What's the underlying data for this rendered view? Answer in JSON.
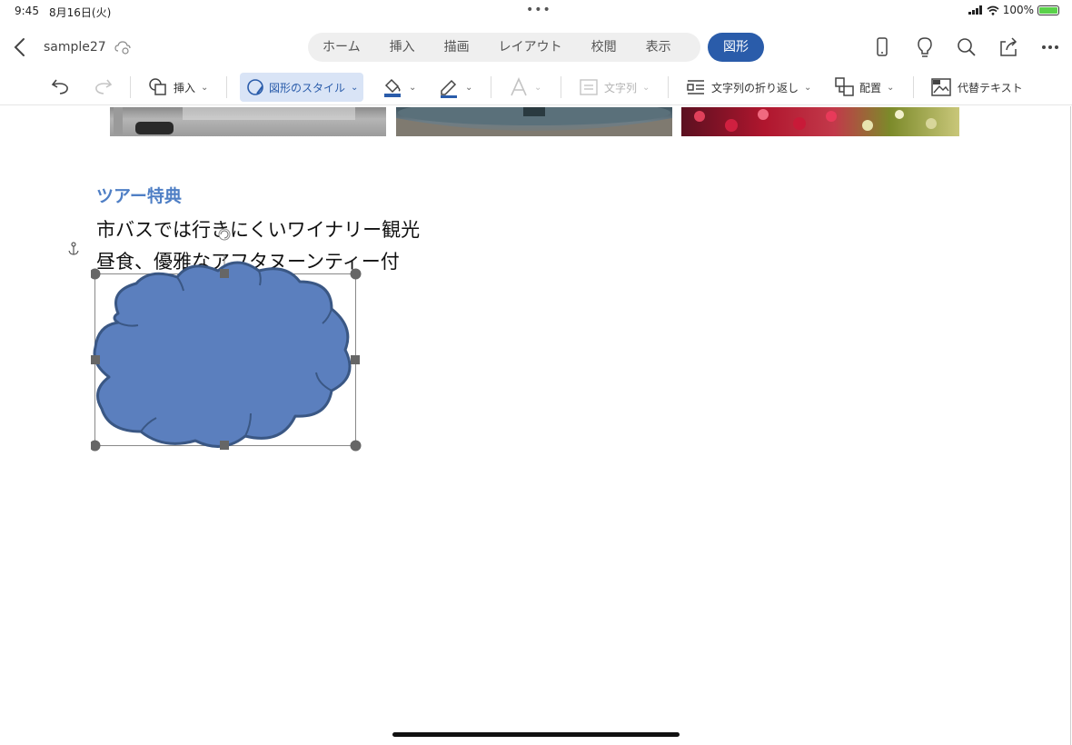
{
  "status": {
    "time": "9:45",
    "date": "8月16日(火)",
    "battery": "100%"
  },
  "header": {
    "doc_name": "sample27",
    "tabs": [
      "ホーム",
      "挿入",
      "描画",
      "レイアウト",
      "校閲",
      "表示"
    ],
    "active_tab": "図形"
  },
  "ribbon": {
    "insert": "挿入",
    "shape_style": "図形のスタイル",
    "text_direction": "文字列",
    "text_wrap": "文字列の折り返し",
    "arrange": "配置",
    "alt_text": "代替テキスト"
  },
  "document": {
    "heading": "ツアー特典",
    "line1": "市バスでは行きにくいワイナリー観光",
    "line2": "昼食、優雅なアフタヌーンティー付"
  },
  "colors": {
    "accent": "#2a5caa",
    "shape_fill": "#5b7fbe",
    "shape_stroke": "#3a5784",
    "heading": "#4f7fc5"
  }
}
